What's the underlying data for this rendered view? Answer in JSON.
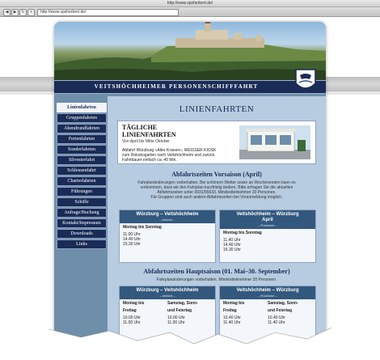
{
  "browser": {
    "window_title": "http://www.vpsherbert.de/",
    "url": "http://www.vpsherbert.de/"
  },
  "header": {
    "banner_text": "VEITSHÖCHHEIMER PERSONENSCHIFFFAHRT"
  },
  "sidebar": {
    "items": [
      {
        "label": "Linienfahrten",
        "active": true
      },
      {
        "label": "Gruppenfahrten"
      },
      {
        "label": "Abendrundfahrten"
      },
      {
        "label": "Ferienfahrten"
      },
      {
        "label": "Sonderfahrten"
      },
      {
        "label": "Silvesterfahrt"
      },
      {
        "label": "Schleusenfahrt"
      },
      {
        "label": "Charterfahrten"
      },
      {
        "label": "Führungen"
      },
      {
        "label": "Schiffe"
      },
      {
        "label": "Anfrage/Buchung"
      },
      {
        "label": "Kontakt/Impressum"
      },
      {
        "label": "Downloads"
      },
      {
        "label": "Links"
      }
    ]
  },
  "main": {
    "title": "LINIENFAHRTEN",
    "intro": {
      "heading_line1": "TÄGLICHE",
      "heading_line2": "LINIENFAHRTEN",
      "subtitle": "Von April bis Mitte Oktober",
      "desc_line1": "Abfahrt Würzburg »Alter Kranen«, WEISSER KIOSK",
      "desc_line2": "zum Rokokogarten nach Veitshöchheim und zurück.",
      "desc_line3": "Fahrtdauer einfach ca. 40 Min."
    },
    "vorsaison": {
      "heading": "Abfahrtszeiten Vorsaison (April)",
      "note1": "Fahrplanänderungen vorbehalten. Bei schönem Wetter sowie an Wochenenden kann es",
      "note2": "vorkommen, dass wir den Fahrplan kurzfristig ändern. Bitte erfragen Sie die aktuellen",
      "note3": "Abfahrtszeiten unter 0931/55633. Mindestteilnehmer 20 Personen.",
      "note4": "Für Gruppen sind auch andere Abfahrtszeiten bei Voranmeldung möglich.",
      "left": {
        "route_line1": "Würzburg – Veitshöchheim",
        "route_line2": "",
        "direction": "– Abfahrt –",
        "day": "Montag bis Sonntag",
        "times": [
          "11.00 Uhr",
          "14.40 Uhr",
          "15.30 Uhr"
        ]
      },
      "right": {
        "route_line1": "Veitshöchheim – Würzburg",
        "route_line2": "April",
        "direction": "– Rückfahrt –",
        "day": "Montag bis Sonntag",
        "times": [
          "11.40 Uhr",
          "14.40 Uhr",
          "16.30 Uhr"
        ]
      }
    },
    "hauptsaison": {
      "heading": "Abfahrtszeiten Hauptsaison (01. Mai–30. September)",
      "note1": "Fahrplanänderungen vorbehalten. Mindestteilnehmer 20 Personen.",
      "left": {
        "route": "Würzburg – Veitshöchheim",
        "direction": "– Abfahrt –",
        "col1_day_line1": "Montag bis",
        "col1_day_line2": "Freitag",
        "col2_day_line1": "Samstag, Sonn-",
        "col2_day_line2": "und Feiertag",
        "col1_times": [
          "10.00 Uhr",
          "11.00 Uhr"
        ],
        "col2_times": [
          "10.00 Uhr",
          "11.00 Uhr"
        ]
      },
      "right": {
        "route": "Veitshöchheim – Würzburg",
        "direction": "– Rückfahrt –",
        "col1_day_line1": "Montag bis",
        "col1_day_line2": "Freitag",
        "col2_day_line1": "Samstag, Sonn-",
        "col2_day_line2": "und Feiertag",
        "col1_times": [
          "10.40 Uhr",
          "11.40 Uhr"
        ],
        "col2_times": [
          "10.40 Uhr",
          "11.40 Uhr"
        ]
      }
    }
  }
}
